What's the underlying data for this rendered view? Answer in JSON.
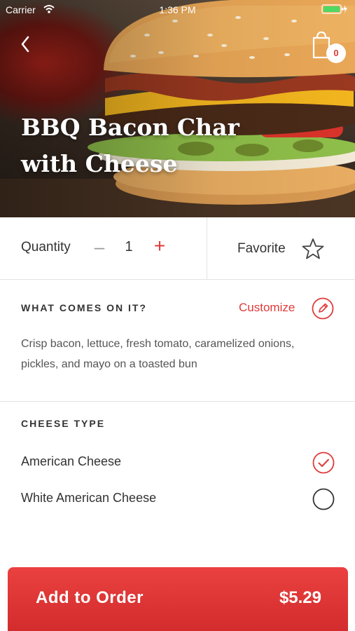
{
  "status_bar": {
    "carrier": "Carrier",
    "time": "1:36 PM"
  },
  "header": {
    "title": "BBQ Bacon Char with Cheese",
    "cart_count": "0"
  },
  "quantity": {
    "label": "Quantity",
    "minus": "–",
    "value": "1",
    "plus": "+"
  },
  "favorite": {
    "label": "Favorite"
  },
  "ingredients": {
    "heading": "WHAT COMES ON IT?",
    "customize_label": "Customize",
    "description": "Crisp bacon, lettuce, fresh tomato, caramelized onions, pickles, and mayo on a toasted bun"
  },
  "cheese": {
    "heading": "CHEESE TYPE",
    "options": [
      {
        "label": "American Cheese",
        "selected": true
      },
      {
        "label": "White American Cheese",
        "selected": false
      }
    ]
  },
  "footer": {
    "button_label": "Add to Order",
    "price": "$5.29"
  },
  "colors": {
    "accent": "#e03a3a",
    "text": "#333333",
    "divider": "#e3e3e3"
  }
}
